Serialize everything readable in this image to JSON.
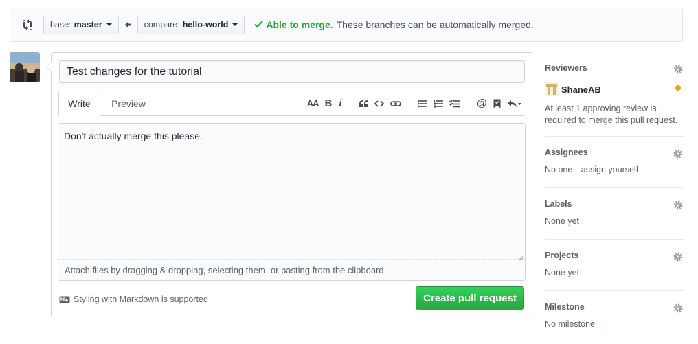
{
  "compare_bar": {
    "base_prefix": "base:",
    "base_branch": "master",
    "compare_prefix": "compare:",
    "compare_branch": "hello-world",
    "merge_status": "Able to merge.",
    "merge_message": "These branches can be automatically merged."
  },
  "form": {
    "title_value": "Test changes for the tutorial",
    "tabs": [
      {
        "label": "Write",
        "active": true
      },
      {
        "label": "Preview",
        "active": false
      }
    ],
    "toolbar": {
      "heading_label": "AA",
      "bold_label": "B",
      "italic_label": "i",
      "mention_label": "@"
    },
    "body_value": "Don't actually merge this please.",
    "attach_note": "Attach files by dragging & dropping, selecting them, or pasting from the clipboard.",
    "markdown_note": "Styling with Markdown is supported",
    "submit_label": "Create pull request"
  },
  "sidebar": {
    "reviewers": {
      "heading": "Reviewers",
      "reviewer_name": "ShaneAB",
      "status_color": "#dbab09",
      "note": "At least 1 approving review is required to merge this pull request."
    },
    "assignees": {
      "heading": "Assignees",
      "value": "No one—assign yourself"
    },
    "labels": {
      "heading": "Labels",
      "value": "None yet"
    },
    "projects": {
      "heading": "Projects",
      "value": "None yet"
    },
    "milestone": {
      "heading": "Milestone",
      "value": "No milestone"
    }
  },
  "colors": {
    "accent_green": "#28a745",
    "text_muted": "#586069",
    "border": "#d1d5da"
  }
}
